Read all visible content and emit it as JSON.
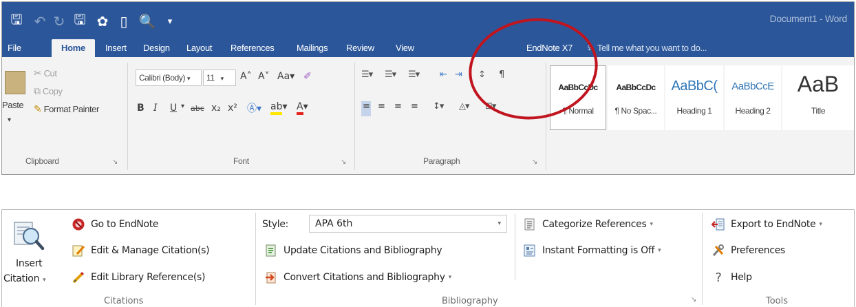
{
  "word": {
    "document_title": "Document1 - Word",
    "tabs": [
      "File",
      "Home",
      "Insert",
      "Design",
      "Layout",
      "References",
      "Mailings",
      "Review",
      "View",
      "EndNote X7"
    ],
    "active_tab": "Home",
    "tell_me": "Tell me what you want to do...",
    "clipboard": {
      "paste": "Paste",
      "cut": "Cut",
      "copy": "Copy",
      "format_painter": "Format Painter",
      "label": "Clipboard"
    },
    "font": {
      "name": "Calibri (Body)",
      "size": "11",
      "label": "Font",
      "bold": "B",
      "italic": "I",
      "underline": "U",
      "strike": "abc",
      "subscript": "x₂",
      "superscript": "x²"
    },
    "paragraph": {
      "label": "Paragraph"
    },
    "styles": [
      {
        "sample": "AaBbCcDc",
        "name": "¶ Normal"
      },
      {
        "sample": "AaBbCcDc",
        "name": "¶ No Spac..."
      },
      {
        "sample": "AaBbC(",
        "name": "Heading 1"
      },
      {
        "sample": "AaBbCcE",
        "name": "Heading 2"
      },
      {
        "sample": "AaB",
        "name": "Title"
      }
    ],
    "annotation_color": "#c0141e",
    "accent_color": "#2b579a"
  },
  "endnote": {
    "citations": {
      "insert_label_1": "Insert",
      "insert_label_2": "Citation",
      "go_to": "Go to EndNote",
      "edit_manage": "Edit & Manage Citation(s)",
      "edit_library": "Edit Library Reference(s)",
      "label": "Citations"
    },
    "bibliography": {
      "style_label": "Style:",
      "style_value": "APA 6th",
      "update": "Update Citations and Bibliography",
      "convert": "Convert Citations and Bibliography",
      "categorize": "Categorize References",
      "instant": "Instant Formatting is Off",
      "label": "Bibliography"
    },
    "tools": {
      "export": "Export to EndNote",
      "preferences": "Preferences",
      "help": "Help",
      "label": "Tools"
    }
  }
}
